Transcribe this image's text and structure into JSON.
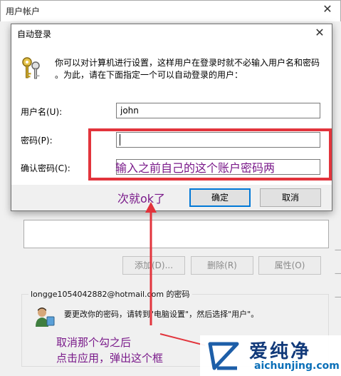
{
  "outer_window": {
    "title": "用户帐户",
    "buttons": {
      "add": "添加(D)...",
      "remove": "删除(R)",
      "properties": "属性(O)"
    },
    "password_group_title": "longge1054042882@hotmail.com 的密码",
    "password_note": "要更改你的密码，请转到\"电脑设置\"，然后选择\"用户\"。"
  },
  "dialog": {
    "title": "自动登录",
    "description_line1": "你可以对计算机进行设置，这样用户在登录时就不必输入用户名和密码",
    "description_line2": "。为此，请在下面指定一个可以自动登录的用户：",
    "fields": {
      "username": {
        "label": "用户名(U):",
        "value": "john"
      },
      "password": {
        "label": "密码(P):",
        "value": ""
      },
      "confirm": {
        "label": "确认密码(C):",
        "value": ""
      }
    },
    "ok_label": "确定",
    "cancel_label": "取消"
  },
  "annotations": {
    "instruction_in_box": "输入之前自己的这个账户密码两",
    "next_ok": "次就ok了",
    "uncheck_line1": "取消那个勾之后",
    "uncheck_line2": "点击应用，弹出这个框"
  },
  "watermark": {
    "cn": "爱纯净",
    "en": "aichunjing.com"
  },
  "colors": {
    "accent_blue": "#0078d7",
    "annotation_red": "#e2343c",
    "annotation_purple": "#7a1a8a"
  }
}
